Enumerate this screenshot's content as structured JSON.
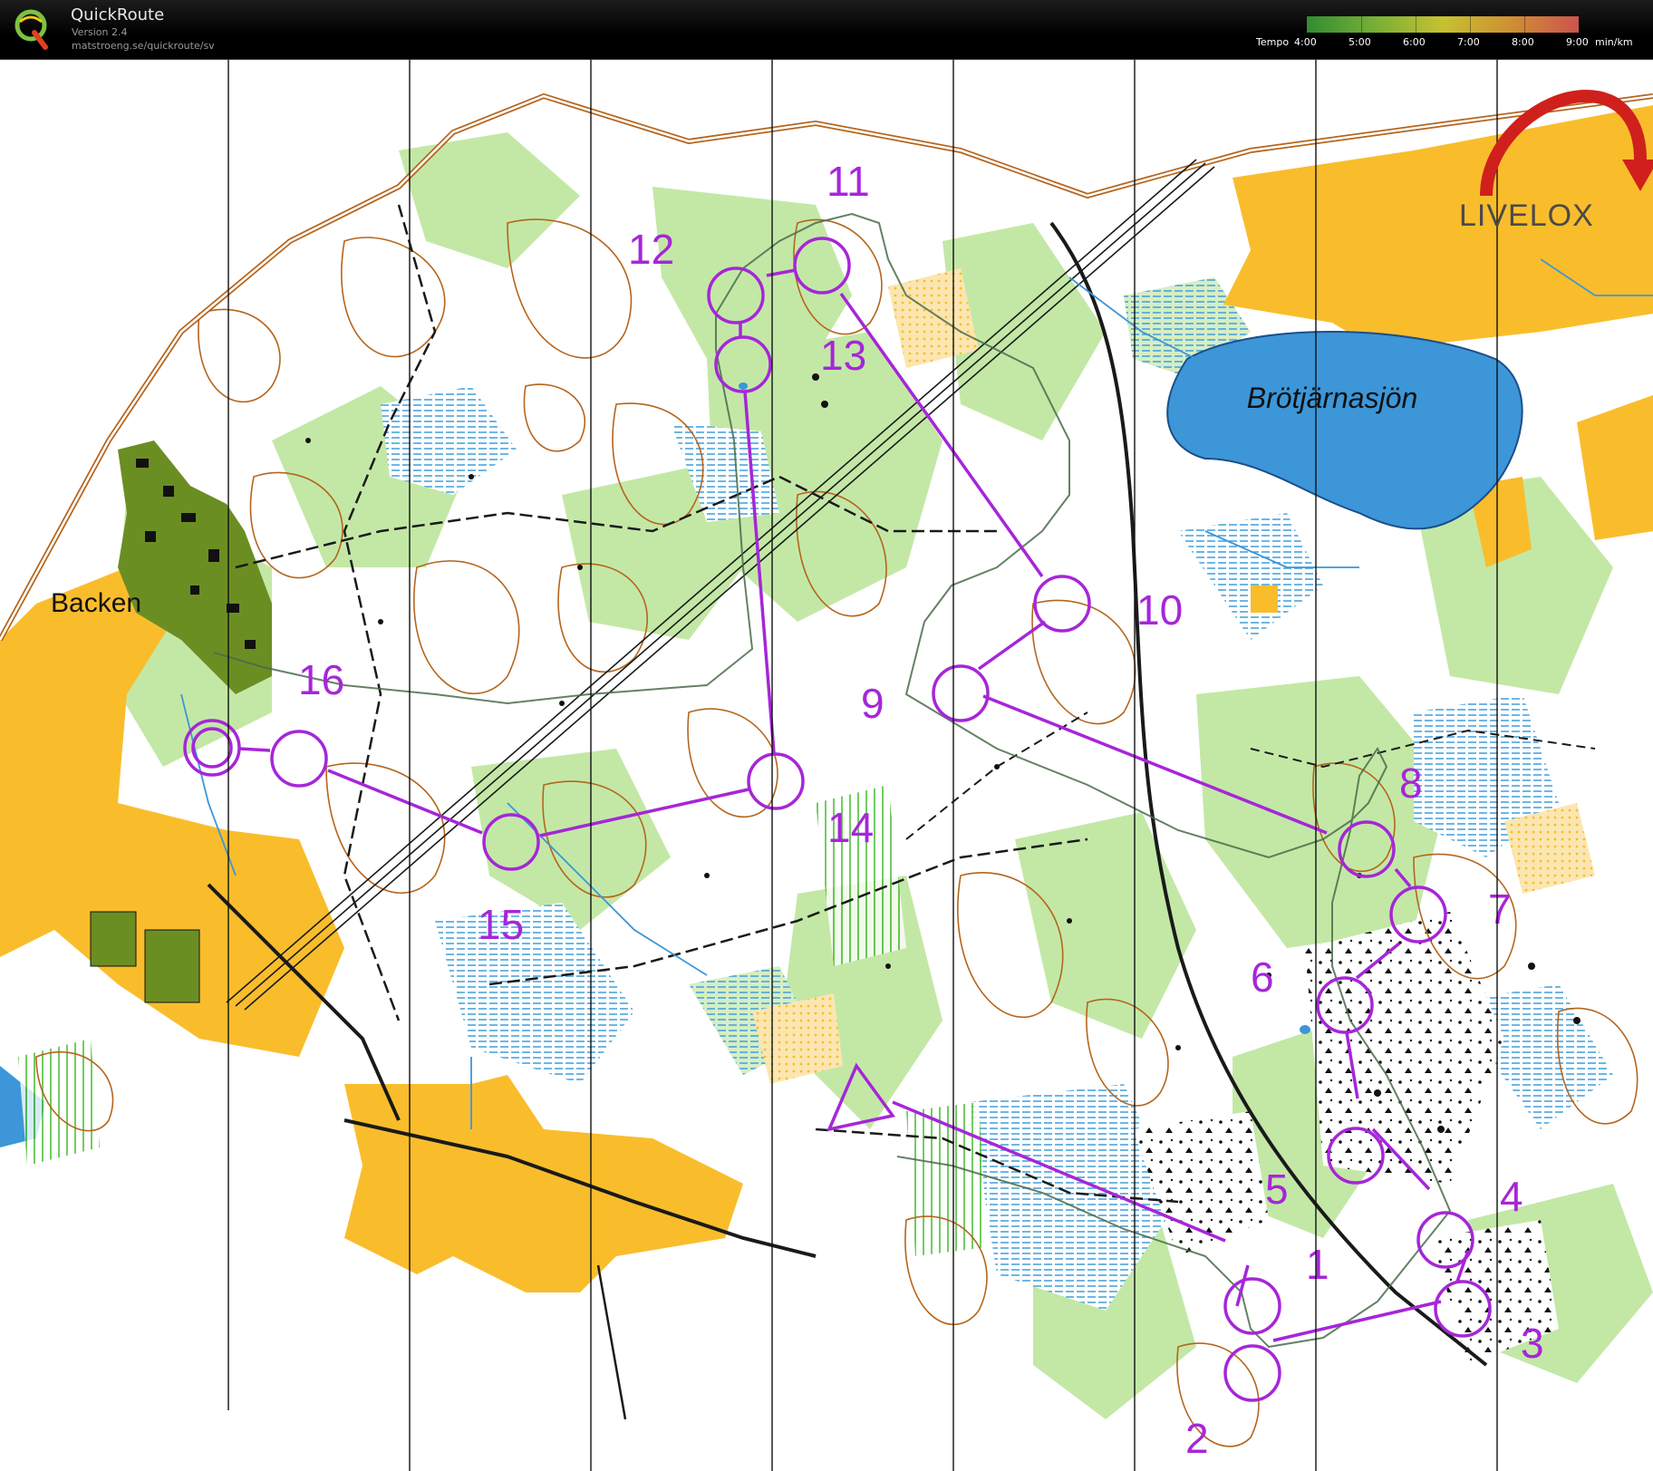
{
  "header": {
    "app_title": "QuickRoute",
    "version": "Version 2.4",
    "url": "matstroeng.se/quickroute/sv",
    "logo_letter": "Q",
    "tempo": {
      "prefix": "Tempo",
      "labels": [
        "4:00",
        "5:00",
        "6:00",
        "7:00",
        "8:00",
        "9:00"
      ],
      "unit": "min/km"
    }
  },
  "map": {
    "lake_name": "Brötjärnasjön",
    "place_name": "Backen",
    "watermark": "LIVELOX",
    "controls": [
      "1",
      "2",
      "3",
      "4",
      "5",
      "6",
      "7",
      "8",
      "9",
      "10",
      "11",
      "12",
      "13",
      "14",
      "15",
      "16"
    ]
  },
  "colors": {
    "course": "#a626d8",
    "open_land": "#f9bd2c",
    "forest_green": "#c3e8a6",
    "water": "#3c96d8",
    "marsh": "#4aa3dd",
    "contour": "#b5651d",
    "road": "#1a1a1a",
    "settlement": "#6b8e23",
    "livelox_red": "#d0201c"
  },
  "icons": [
    "quickroute-logo-icon",
    "livelox-arrow-icon"
  ]
}
